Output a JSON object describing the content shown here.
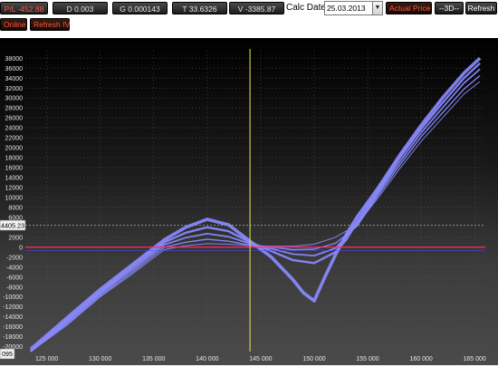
{
  "toolbar": {
    "pl": "P/L -452.88",
    "delta": "D 0.003",
    "gamma": "G 0.000143",
    "theta": "T 33.6326",
    "vega": "V -3385.87",
    "calc_date_label": "Calc Date:",
    "calc_date_value": "25.03.2013",
    "actual_price_label": "Actual Price",
    "three_d_label": "--3D--",
    "refresh_label": "Refresh",
    "online_label": "Online",
    "refresh_iv_label": "Refresh IV"
  },
  "chart": {
    "current_price_marker": "4405.23",
    "bottom_left_marker": "095",
    "colors": {
      "curve": "#8a8aff",
      "zero_line": "#ff2a6a",
      "cursor": "#d8d850",
      "background": "#000000"
    }
  },
  "chart_data": {
    "type": "line",
    "x_ticks": [
      "125 000",
      "130 000",
      "135 000",
      "140 000",
      "145 000",
      "150 000",
      "155 000",
      "160 000",
      "165 000"
    ],
    "y_ticks": [
      "38000",
      "36000",
      "34000",
      "32000",
      "30000",
      "28000",
      "26000",
      "24000",
      "22000",
      "20000",
      "18000",
      "16000",
      "14000",
      "12000",
      "10000",
      "8000",
      "6000",
      "4000",
      "2000",
      "0",
      "-2000",
      "-4000",
      "-6000",
      "-8000",
      "-10000",
      "-12000",
      "-14000",
      "-16000",
      "-18000",
      "-20000"
    ],
    "xlim": [
      123000,
      166000
    ],
    "ylim": [
      -21000,
      39500
    ],
    "cursor_x": 144000,
    "current_value": 4405.23,
    "series": [
      {
        "points": [
          [
            123500,
            -20500
          ],
          [
            127000,
            -14000
          ],
          [
            130000,
            -8500
          ],
          [
            133000,
            -3500
          ],
          [
            136000,
            1500
          ],
          [
            138000,
            4000
          ],
          [
            140000,
            5600
          ],
          [
            142000,
            4500
          ],
          [
            144000,
            1200
          ],
          [
            146000,
            -2000
          ],
          [
            148000,
            -6500
          ],
          [
            149000,
            -9200
          ],
          [
            150000,
            -10800
          ],
          [
            151000,
            -6000
          ],
          [
            152000,
            -1500
          ],
          [
            153000,
            2500
          ],
          [
            154000,
            6000
          ],
          [
            156000,
            12000
          ],
          [
            158000,
            18500
          ],
          [
            160000,
            24500
          ],
          [
            162000,
            30000
          ],
          [
            164000,
            35000
          ],
          [
            165500,
            38000
          ]
        ]
      },
      {
        "points": [
          [
            123500,
            -20800
          ],
          [
            127000,
            -14500
          ],
          [
            130000,
            -9000
          ],
          [
            133000,
            -4000
          ],
          [
            136000,
            1000
          ],
          [
            138000,
            2900
          ],
          [
            140000,
            4000
          ],
          [
            142000,
            3200
          ],
          [
            144000,
            1000
          ],
          [
            146000,
            -800
          ],
          [
            148000,
            -2600
          ],
          [
            150000,
            -3200
          ],
          [
            152000,
            -1000
          ],
          [
            153000,
            1500
          ],
          [
            154000,
            5000
          ],
          [
            156000,
            11500
          ],
          [
            158000,
            18000
          ],
          [
            160000,
            23800
          ],
          [
            162000,
            29000
          ],
          [
            164000,
            34000
          ],
          [
            165500,
            37000
          ]
        ]
      },
      {
        "points": [
          [
            123500,
            -21000
          ],
          [
            127000,
            -14800
          ],
          [
            130000,
            -9300
          ],
          [
            133000,
            -4500
          ],
          [
            136000,
            500
          ],
          [
            138000,
            1900
          ],
          [
            140000,
            2700
          ],
          [
            142000,
            2100
          ],
          [
            144000,
            700
          ],
          [
            146000,
            -300
          ],
          [
            148000,
            -1400
          ],
          [
            150000,
            -1700
          ],
          [
            152000,
            -200
          ],
          [
            154000,
            4500
          ],
          [
            156000,
            11000
          ],
          [
            158000,
            17200
          ],
          [
            160000,
            23000
          ],
          [
            162000,
            28000
          ],
          [
            164000,
            33000
          ],
          [
            165500,
            35800
          ]
        ]
      },
      {
        "points": [
          [
            123500,
            -21000
          ],
          [
            127000,
            -15200
          ],
          [
            130000,
            -9700
          ],
          [
            133000,
            -5000
          ],
          [
            136000,
            0
          ],
          [
            138000,
            1000
          ],
          [
            140000,
            1600
          ],
          [
            142000,
            1200
          ],
          [
            144000,
            400
          ],
          [
            146000,
            0
          ],
          [
            148000,
            -500
          ],
          [
            150000,
            -400
          ],
          [
            152000,
            800
          ],
          [
            154000,
            4200
          ],
          [
            156000,
            10500
          ],
          [
            158000,
            16500
          ],
          [
            160000,
            22200
          ],
          [
            162000,
            27000
          ],
          [
            164000,
            31800
          ],
          [
            165500,
            34500
          ]
        ]
      },
      {
        "points": [
          [
            123500,
            -21000
          ],
          [
            127000,
            -15500
          ],
          [
            130000,
            -10000
          ],
          [
            133000,
            -5400
          ],
          [
            136000,
            -500
          ],
          [
            138000,
            300
          ],
          [
            140000,
            700
          ],
          [
            142000,
            600
          ],
          [
            144000,
            300
          ],
          [
            146000,
            200
          ],
          [
            148000,
            200
          ],
          [
            150000,
            600
          ],
          [
            152000,
            2000
          ],
          [
            154000,
            4500
          ],
          [
            156000,
            10000
          ],
          [
            158000,
            15800
          ],
          [
            160000,
            21300
          ],
          [
            162000,
            26000
          ],
          [
            164000,
            30800
          ],
          [
            165500,
            33300
          ]
        ]
      }
    ]
  }
}
